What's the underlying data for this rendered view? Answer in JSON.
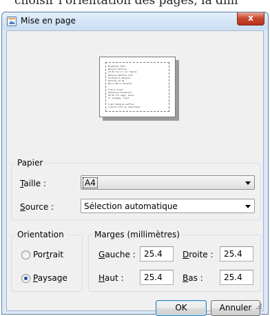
{
  "background_caption": "choisir l'orientation des pages, la dim",
  "window": {
    "title": "Mise en page",
    "close_glyph": "x",
    "app_icon": "page-setup-icon",
    "colors": {
      "frame": "#dce9f7",
      "close": "#c9452c",
      "client": "#f0f0f0"
    }
  },
  "preview": {
    "text_lines": [
      "Breakfast Menu",
      "Belgian Waffles",
      "$5.95 Two of our famous",
      "Belgian Waffles with",
      "Strawberry Belgian",
      "Waffles $7.95",
      "Berry-Berry Belgian",
      "",
      "French Toast",
      "Homestyle Breakfast",
      "$6.95 Two eggs, bacon",
      "or sausage, toast",
      "",
      "Light Belgian waffles",
      "covered with an assortment"
    ]
  },
  "paper": {
    "legend": "Papier",
    "size_label_prefix": "",
    "size_label_hotkey": "T",
    "size_label_rest": "aille :",
    "size_value": "A4",
    "source_label_hotkey": "S",
    "source_label_rest": "ource :",
    "source_value": "Sélection automatique"
  },
  "orientation": {
    "legend": "Orientation",
    "portrait_prefix": "Por",
    "portrait_hotkey": "t",
    "portrait_rest": "rait",
    "landscape_hotkey": "P",
    "landscape_rest": "aysage",
    "selected": "Paysage"
  },
  "margins": {
    "legend": "Marges (millimètres)",
    "left_hotkey": "G",
    "left_rest": "auche :",
    "left_value": "25.4",
    "right_hotkey": "D",
    "right_rest": "roite :",
    "right_value": "25.4",
    "top_hotkey": "H",
    "top_rest": "aut :",
    "top_value": "25.4",
    "bottom_hotkey": "B",
    "bottom_rest": "as :",
    "bottom_value": "25.4"
  },
  "buttons": {
    "ok": "OK",
    "cancel": "Annuler"
  }
}
